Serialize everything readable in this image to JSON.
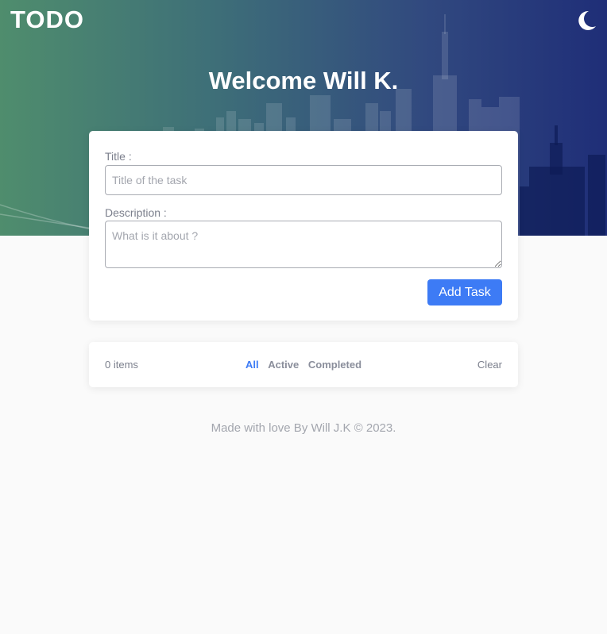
{
  "app": {
    "brand": "TODO",
    "theme_icon": "moon-icon"
  },
  "header": {
    "welcome": "Welcome Will K."
  },
  "form": {
    "title_label": "Title :",
    "title_placeholder": "Title of the task",
    "title_value": "",
    "description_label": "Description :",
    "description_placeholder": "What is it about ?",
    "description_value": "",
    "add_button": "Add Task"
  },
  "list_footer": {
    "items_count": "0 items",
    "filters": [
      {
        "label": "All",
        "active": true
      },
      {
        "label": "Active",
        "active": false
      },
      {
        "label": "Completed",
        "active": false
      }
    ],
    "clear": "Clear"
  },
  "footer": {
    "credit": "Made with love By Will J.K © 2023."
  },
  "colors": {
    "accent": "#3d7bf5",
    "hero_start": "#4f8d6d",
    "hero_end": "#1f2e78",
    "background": "#fafafa"
  }
}
